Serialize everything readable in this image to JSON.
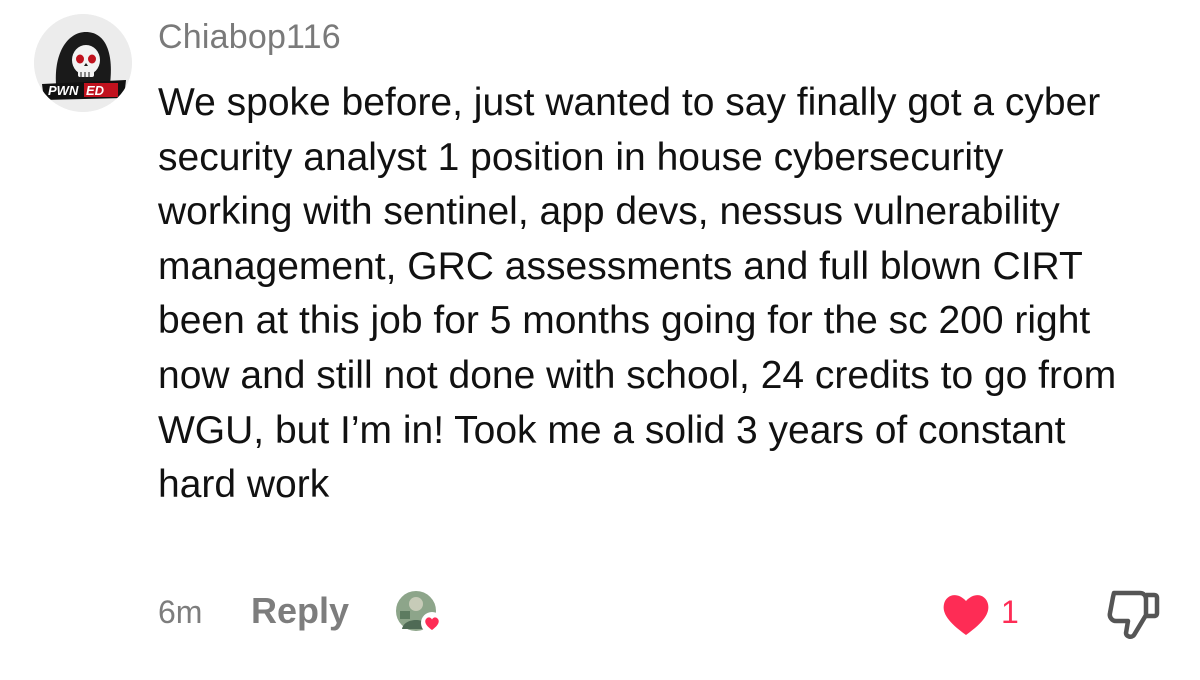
{
  "comment": {
    "username": "Chiabop116",
    "avatar_icon": "skull-logo",
    "avatar_text": "PWNED",
    "text": "We spoke before, just wanted to say finally got a cyber security analyst 1 position in house cybersecurity working with sentinel, app devs, nessus vulnerability management, GRC assessments and full blown CIRT been at this job for 5 months going for the sc 200 right now and still not done with school, 24 credits to go from WGU, but I’m in! Took me a solid 3 years of constant hard work",
    "timestamp": "6m",
    "reply_label": "Reply",
    "like_count": "1",
    "like_icon": "heart-icon",
    "dislike_icon": "thumbs-down-icon",
    "liked_by_icon": "liker-avatar"
  },
  "colors": {
    "accent": "#fe2c55",
    "muted_text": "#7d7d7d",
    "body_text": "#111111"
  }
}
